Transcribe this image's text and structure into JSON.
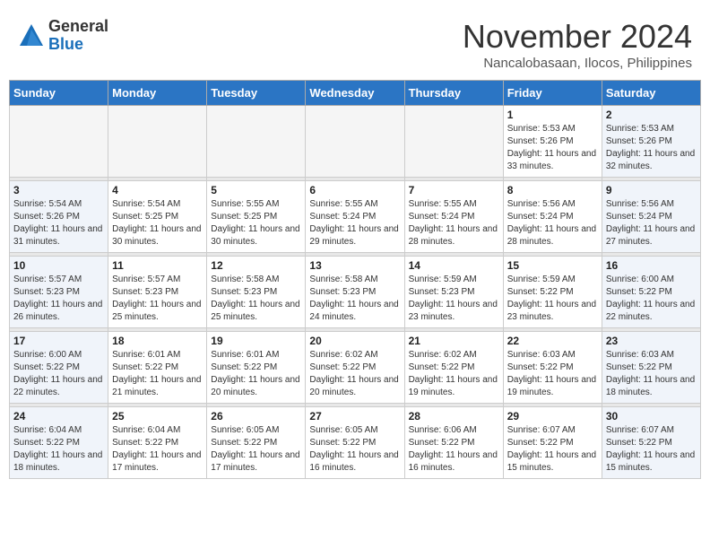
{
  "header": {
    "logo_general": "General",
    "logo_blue": "Blue",
    "month_title": "November 2024",
    "location": "Nancalobasaan, Ilocos, Philippines"
  },
  "weekdays": [
    "Sunday",
    "Monday",
    "Tuesday",
    "Wednesday",
    "Thursday",
    "Friday",
    "Saturday"
  ],
  "weeks": [
    [
      {
        "day": "",
        "sunrise": "",
        "sunset": "",
        "daylight": "",
        "empty": true
      },
      {
        "day": "",
        "sunrise": "",
        "sunset": "",
        "daylight": "",
        "empty": true
      },
      {
        "day": "",
        "sunrise": "",
        "sunset": "",
        "daylight": "",
        "empty": true
      },
      {
        "day": "",
        "sunrise": "",
        "sunset": "",
        "daylight": "",
        "empty": true
      },
      {
        "day": "",
        "sunrise": "",
        "sunset": "",
        "daylight": "",
        "empty": true
      },
      {
        "day": "1",
        "sunrise": "Sunrise: 5:53 AM",
        "sunset": "Sunset: 5:26 PM",
        "daylight": "Daylight: 11 hours and 33 minutes.",
        "empty": false,
        "weekend": false
      },
      {
        "day": "2",
        "sunrise": "Sunrise: 5:53 AM",
        "sunset": "Sunset: 5:26 PM",
        "daylight": "Daylight: 11 hours and 32 minutes.",
        "empty": false,
        "weekend": true
      }
    ],
    [
      {
        "day": "3",
        "sunrise": "Sunrise: 5:54 AM",
        "sunset": "Sunset: 5:26 PM",
        "daylight": "Daylight: 11 hours and 31 minutes.",
        "empty": false,
        "weekend": true
      },
      {
        "day": "4",
        "sunrise": "Sunrise: 5:54 AM",
        "sunset": "Sunset: 5:25 PM",
        "daylight": "Daylight: 11 hours and 30 minutes.",
        "empty": false,
        "weekend": false
      },
      {
        "day": "5",
        "sunrise": "Sunrise: 5:55 AM",
        "sunset": "Sunset: 5:25 PM",
        "daylight": "Daylight: 11 hours and 30 minutes.",
        "empty": false,
        "weekend": false
      },
      {
        "day": "6",
        "sunrise": "Sunrise: 5:55 AM",
        "sunset": "Sunset: 5:24 PM",
        "daylight": "Daylight: 11 hours and 29 minutes.",
        "empty": false,
        "weekend": false
      },
      {
        "day": "7",
        "sunrise": "Sunrise: 5:55 AM",
        "sunset": "Sunset: 5:24 PM",
        "daylight": "Daylight: 11 hours and 28 minutes.",
        "empty": false,
        "weekend": false
      },
      {
        "day": "8",
        "sunrise": "Sunrise: 5:56 AM",
        "sunset": "Sunset: 5:24 PM",
        "daylight": "Daylight: 11 hours and 28 minutes.",
        "empty": false,
        "weekend": false
      },
      {
        "day": "9",
        "sunrise": "Sunrise: 5:56 AM",
        "sunset": "Sunset: 5:24 PM",
        "daylight": "Daylight: 11 hours and 27 minutes.",
        "empty": false,
        "weekend": true
      }
    ],
    [
      {
        "day": "10",
        "sunrise": "Sunrise: 5:57 AM",
        "sunset": "Sunset: 5:23 PM",
        "daylight": "Daylight: 11 hours and 26 minutes.",
        "empty": false,
        "weekend": true
      },
      {
        "day": "11",
        "sunrise": "Sunrise: 5:57 AM",
        "sunset": "Sunset: 5:23 PM",
        "daylight": "Daylight: 11 hours and 25 minutes.",
        "empty": false,
        "weekend": false
      },
      {
        "day": "12",
        "sunrise": "Sunrise: 5:58 AM",
        "sunset": "Sunset: 5:23 PM",
        "daylight": "Daylight: 11 hours and 25 minutes.",
        "empty": false,
        "weekend": false
      },
      {
        "day": "13",
        "sunrise": "Sunrise: 5:58 AM",
        "sunset": "Sunset: 5:23 PM",
        "daylight": "Daylight: 11 hours and 24 minutes.",
        "empty": false,
        "weekend": false
      },
      {
        "day": "14",
        "sunrise": "Sunrise: 5:59 AM",
        "sunset": "Sunset: 5:23 PM",
        "daylight": "Daylight: 11 hours and 23 minutes.",
        "empty": false,
        "weekend": false
      },
      {
        "day": "15",
        "sunrise": "Sunrise: 5:59 AM",
        "sunset": "Sunset: 5:22 PM",
        "daylight": "Daylight: 11 hours and 23 minutes.",
        "empty": false,
        "weekend": false
      },
      {
        "day": "16",
        "sunrise": "Sunrise: 6:00 AM",
        "sunset": "Sunset: 5:22 PM",
        "daylight": "Daylight: 11 hours and 22 minutes.",
        "empty": false,
        "weekend": true
      }
    ],
    [
      {
        "day": "17",
        "sunrise": "Sunrise: 6:00 AM",
        "sunset": "Sunset: 5:22 PM",
        "daylight": "Daylight: 11 hours and 22 minutes.",
        "empty": false,
        "weekend": true
      },
      {
        "day": "18",
        "sunrise": "Sunrise: 6:01 AM",
        "sunset": "Sunset: 5:22 PM",
        "daylight": "Daylight: 11 hours and 21 minutes.",
        "empty": false,
        "weekend": false
      },
      {
        "day": "19",
        "sunrise": "Sunrise: 6:01 AM",
        "sunset": "Sunset: 5:22 PM",
        "daylight": "Daylight: 11 hours and 20 minutes.",
        "empty": false,
        "weekend": false
      },
      {
        "day": "20",
        "sunrise": "Sunrise: 6:02 AM",
        "sunset": "Sunset: 5:22 PM",
        "daylight": "Daylight: 11 hours and 20 minutes.",
        "empty": false,
        "weekend": false
      },
      {
        "day": "21",
        "sunrise": "Sunrise: 6:02 AM",
        "sunset": "Sunset: 5:22 PM",
        "daylight": "Daylight: 11 hours and 19 minutes.",
        "empty": false,
        "weekend": false
      },
      {
        "day": "22",
        "sunrise": "Sunrise: 6:03 AM",
        "sunset": "Sunset: 5:22 PM",
        "daylight": "Daylight: 11 hours and 19 minutes.",
        "empty": false,
        "weekend": false
      },
      {
        "day": "23",
        "sunrise": "Sunrise: 6:03 AM",
        "sunset": "Sunset: 5:22 PM",
        "daylight": "Daylight: 11 hours and 18 minutes.",
        "empty": false,
        "weekend": true
      }
    ],
    [
      {
        "day": "24",
        "sunrise": "Sunrise: 6:04 AM",
        "sunset": "Sunset: 5:22 PM",
        "daylight": "Daylight: 11 hours and 18 minutes.",
        "empty": false,
        "weekend": true
      },
      {
        "day": "25",
        "sunrise": "Sunrise: 6:04 AM",
        "sunset": "Sunset: 5:22 PM",
        "daylight": "Daylight: 11 hours and 17 minutes.",
        "empty": false,
        "weekend": false
      },
      {
        "day": "26",
        "sunrise": "Sunrise: 6:05 AM",
        "sunset": "Sunset: 5:22 PM",
        "daylight": "Daylight: 11 hours and 17 minutes.",
        "empty": false,
        "weekend": false
      },
      {
        "day": "27",
        "sunrise": "Sunrise: 6:05 AM",
        "sunset": "Sunset: 5:22 PM",
        "daylight": "Daylight: 11 hours and 16 minutes.",
        "empty": false,
        "weekend": false
      },
      {
        "day": "28",
        "sunrise": "Sunrise: 6:06 AM",
        "sunset": "Sunset: 5:22 PM",
        "daylight": "Daylight: 11 hours and 16 minutes.",
        "empty": false,
        "weekend": false
      },
      {
        "day": "29",
        "sunrise": "Sunrise: 6:07 AM",
        "sunset": "Sunset: 5:22 PM",
        "daylight": "Daylight: 11 hours and 15 minutes.",
        "empty": false,
        "weekend": false
      },
      {
        "day": "30",
        "sunrise": "Sunrise: 6:07 AM",
        "sunset": "Sunset: 5:22 PM",
        "daylight": "Daylight: 11 hours and 15 minutes.",
        "empty": false,
        "weekend": true
      }
    ]
  ]
}
